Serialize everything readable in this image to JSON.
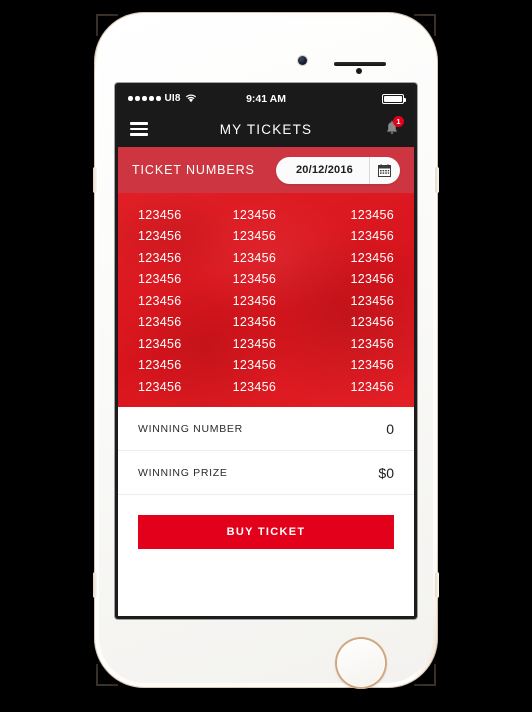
{
  "status_bar": {
    "signal_dots": 5,
    "carrier": "UI8",
    "wifi_icon": "wifi-icon",
    "time": "9:41 AM",
    "battery_icon": "battery-full-icon"
  },
  "nav_bar": {
    "menu_icon": "hamburger-menu-icon",
    "title": "MY TICKETS",
    "bell_icon": "notification-bell-icon",
    "badge_count": "1"
  },
  "ticket_header": {
    "title": "TICKET NUMBERS",
    "date_value": "20/12/2016",
    "calendar_icon": "calendar-icon"
  },
  "ticket_grid": {
    "rows": [
      [
        "123456",
        "123456",
        "123456"
      ],
      [
        "123456",
        "123456",
        "123456"
      ],
      [
        "123456",
        "123456",
        "123456"
      ],
      [
        "123456",
        "123456",
        "123456"
      ],
      [
        "123456",
        "123456",
        "123456"
      ],
      [
        "123456",
        "123456",
        "123456"
      ],
      [
        "123456",
        "123456",
        "123456"
      ],
      [
        "123456",
        "123456",
        "123456"
      ],
      [
        "123456",
        "123456",
        "123456"
      ]
    ]
  },
  "info_rows": [
    {
      "label": "WINNING NUMBER",
      "value": "0"
    },
    {
      "label": "WINNING PRIZE",
      "value": "$0"
    }
  ],
  "actions": {
    "buy_label": "BUY TICKET"
  },
  "colors": {
    "brand_red": "#e3001b",
    "header_red": "#cd3640",
    "grid_red": "#e11f26",
    "bar_dark": "#1a1a1a"
  }
}
